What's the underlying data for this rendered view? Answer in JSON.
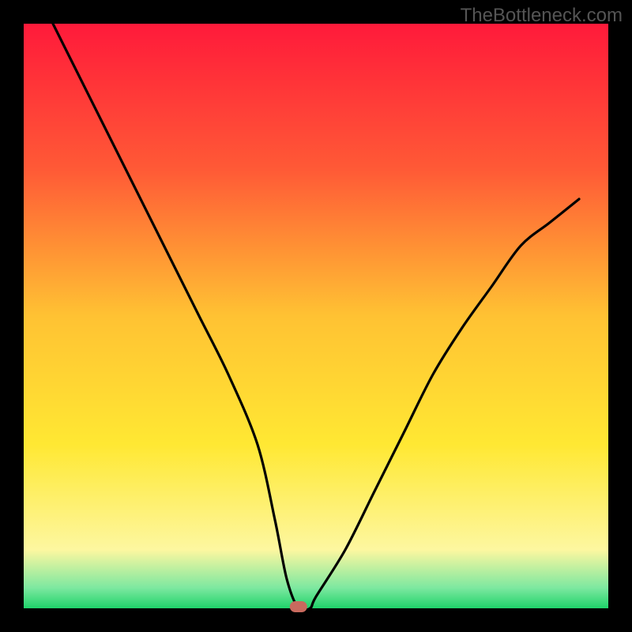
{
  "watermark": "TheBottleneck.com",
  "chart_data": {
    "type": "line",
    "title": "",
    "xlabel": "",
    "ylabel": "",
    "xlim": [
      0,
      100
    ],
    "ylim": [
      0,
      100
    ],
    "minimum_x": 47,
    "marker": {
      "x": 47,
      "y": 0,
      "color": "#c96a5e"
    },
    "series": [
      {
        "name": "bottleneck-curve",
        "x": [
          5,
          10,
          15,
          20,
          25,
          30,
          35,
          40,
          43,
          45,
          47,
          49,
          50,
          55,
          60,
          65,
          70,
          75,
          80,
          85,
          90,
          95
        ],
        "values": [
          100,
          90,
          80,
          70,
          60,
          50,
          40,
          28,
          15,
          5,
          0,
          0,
          2,
          10,
          20,
          30,
          40,
          48,
          55,
          62,
          66,
          70
        ]
      }
    ],
    "background_gradient": {
      "stops": [
        {
          "pos": 0.0,
          "color": "#ff1a3a"
        },
        {
          "pos": 0.25,
          "color": "#ff5a36"
        },
        {
          "pos": 0.5,
          "color": "#ffc233"
        },
        {
          "pos": 0.72,
          "color": "#ffe833"
        },
        {
          "pos": 0.9,
          "color": "#fdf7a0"
        },
        {
          "pos": 0.965,
          "color": "#7de8a0"
        },
        {
          "pos": 1.0,
          "color": "#1fd36a"
        }
      ]
    },
    "frame": {
      "outer_w": 800,
      "outer_h": 800,
      "inner_x": 30,
      "inner_y": 30,
      "inner_w": 740,
      "inner_h": 740
    }
  }
}
